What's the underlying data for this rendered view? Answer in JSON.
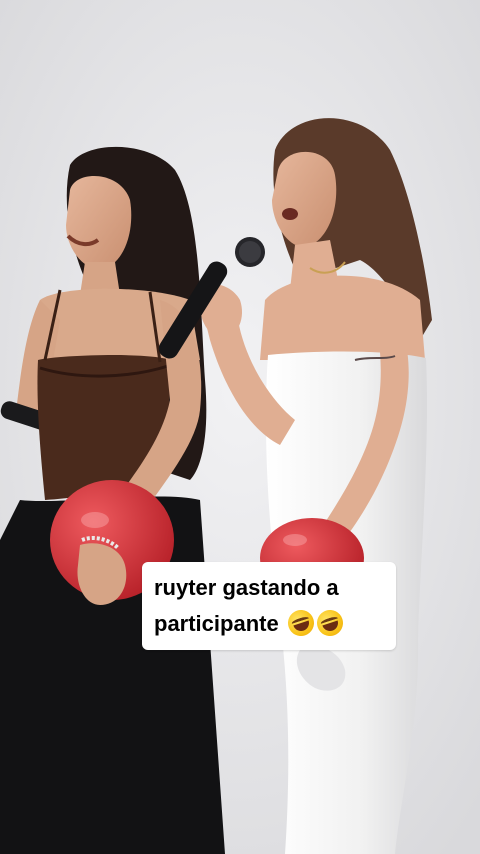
{
  "caption": {
    "line1": "ruyter gastando a",
    "line2": "participante",
    "emoji": "rolling-on-floor-laughing-emoji",
    "emoji_count": 2
  },
  "colors": {
    "background": "#e6e6e8",
    "caption_bg": "#ffffff",
    "caption_text": "#000000",
    "balloon": "#d8343a",
    "brown_top": "#4a2a1c",
    "white_dress": "#f4f4f4"
  }
}
